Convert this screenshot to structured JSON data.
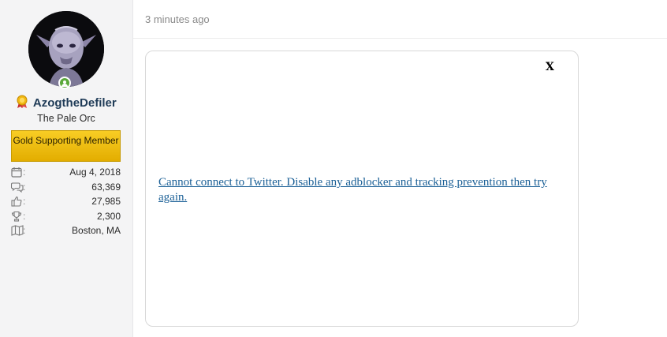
{
  "author": {
    "username": "AzogtheDefiler",
    "user_title": "The Pale Orc",
    "banner": "Gold Supporting Member",
    "online": true,
    "stats": [
      {
        "icon": "calendar-icon",
        "value": "Aug 4, 2018"
      },
      {
        "icon": "comments-icon",
        "value": "63,369"
      },
      {
        "icon": "thumbs-up-icon",
        "value": "27,985"
      },
      {
        "icon": "trophy-icon",
        "value": "2,300"
      },
      {
        "icon": "map-icon",
        "value": "Boston, MA"
      }
    ]
  },
  "post": {
    "timestamp": "3 minutes ago",
    "embed": {
      "close_label": "X",
      "error_text": "Cannot connect to Twitter. Disable any adblocker and tracking prevention then try again."
    }
  },
  "colors": {
    "link": "#1a5f96",
    "username": "#1f3b57",
    "banner": "#f2be10",
    "online": "#5aa83a"
  }
}
